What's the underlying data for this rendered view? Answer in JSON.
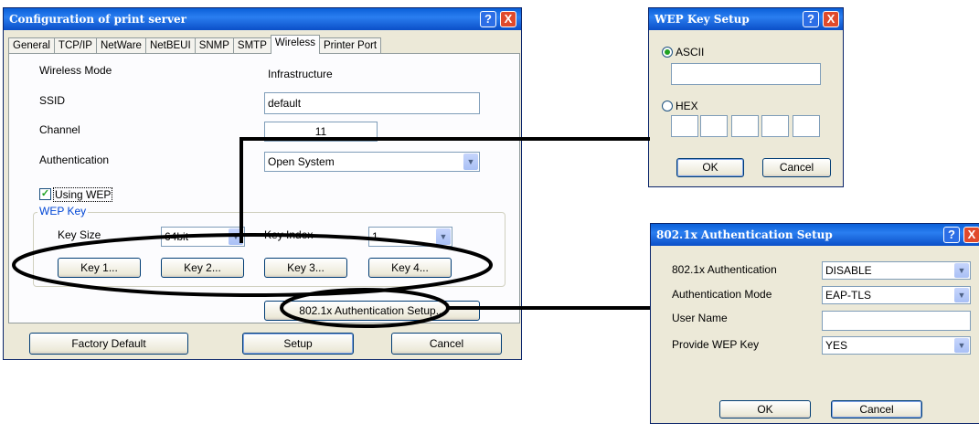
{
  "main_window": {
    "title": "Configuration of print server",
    "tabs": [
      "General",
      "TCP/IP",
      "NetWare",
      "NetBEUI",
      "SNMP",
      "SMTP",
      "Wireless",
      "Printer Port"
    ],
    "active_tab": "Wireless",
    "wireless_mode_label": "Wireless Mode",
    "wireless_mode_value": "Infrastructure",
    "ssid_label": "SSID",
    "ssid_value": "default",
    "channel_label": "Channel",
    "channel_value": "11",
    "auth_label": "Authentication",
    "auth_value": "Open System",
    "using_wep_label": "Using WEP",
    "using_wep_checked": true,
    "wep_key_group": "WEP Key",
    "key_size_label": "Key Size",
    "key_size_value": "64bit",
    "key_index_label": "Key Index",
    "key_index_value": "1",
    "key_buttons": [
      "Key 1...",
      "Key 2...",
      "Key 3...",
      "Key 4..."
    ],
    "auth_setup_button": "802.1x Authentication Setup...",
    "factory_default_button": "Factory Default",
    "setup_button": "Setup",
    "cancel_button": "Cancel"
  },
  "wep_dialog": {
    "title": "WEP Key Setup",
    "ascii_label": "ASCII",
    "ascii_value": "",
    "hex_label": "HEX",
    "selected": "ASCII",
    "ok_button": "OK",
    "cancel_button": "Cancel"
  },
  "auth_dialog": {
    "title": "802.1x Authentication Setup",
    "auth_label": "802.1x Authentication",
    "auth_value": "DISABLE",
    "mode_label": "Authentication Mode",
    "mode_value": "EAP-TLS",
    "username_label": "User Name",
    "username_value": "",
    "provide_wep_label": "Provide WEP Key",
    "provide_wep_value": "YES",
    "ok_button": "OK",
    "cancel_button": "Cancel"
  },
  "title_buttons": {
    "help": "?",
    "close": "X"
  },
  "icons": {
    "dropdown": "chevron-down-icon",
    "check": "checkmark-icon"
  },
  "colors": {
    "titlebar": "#0a5fd8",
    "window_bg": "#ece9d8",
    "accent_group": "#0046d5"
  }
}
